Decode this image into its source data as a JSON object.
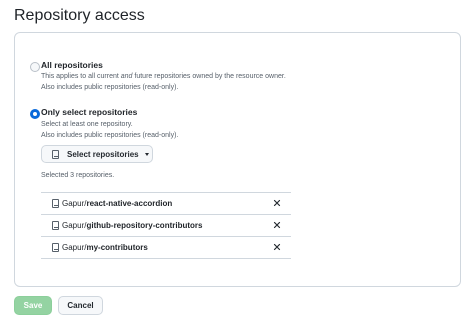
{
  "page": {
    "title": "Repository access"
  },
  "options": {
    "all": {
      "label": "All repositories",
      "desc_prefix": "This applies to all current ",
      "desc_emphasis": "and",
      "desc_suffix": " future repositories owned by the resource owner.",
      "note": "Also includes public repositories (read-only).",
      "selected": false
    },
    "select": {
      "label": "Only select repositories",
      "desc": "Select at least one repository.",
      "note": "Also includes public repositories (read-only).",
      "selected": true
    }
  },
  "select_button": {
    "label": "Select repositories"
  },
  "selected_count_text": "Selected 3 repositories.",
  "repositories": [
    {
      "owner": "Gapur/",
      "name": "react-native-accordion"
    },
    {
      "owner": "Gapur/",
      "name": "github-repository-contributors"
    },
    {
      "owner": "Gapur/",
      "name": "my-contributors"
    }
  ],
  "actions": {
    "save": "Save",
    "cancel": "Cancel"
  },
  "colors": {
    "accent": "#0969da",
    "save_disabled": "#94d3a2",
    "border": "#d0d7de"
  }
}
